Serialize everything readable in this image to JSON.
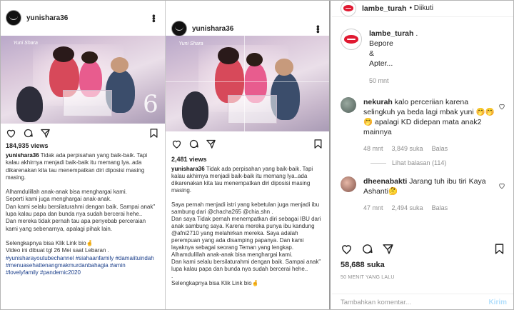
{
  "post1": {
    "username": "yunishara36",
    "views": "184,935 views",
    "caption_user": "yunishara36",
    "caption_paragraphs": [
      " Tidak ada perpisahan yang baik-baik.  Tapi kalau akhirnya menjadi baik-baik itu memang lya..ada dikarenakan kita tau menempatkan diri diposisi masing masing.",
      "",
      "Alhamdulillah anak-anak bisa menghargai kami.",
      "Seperti kami juga menghargai anak-anak.",
      "Dan kami selalu bersilaturahmi dengan baik. Sampai anak\" lupa kalau papa dan bunda nya sudah bercerai hehe..",
      "Dan mereka tidak pernah tau apa penyebab perceraian kami yang sebenarnya, apalagi pihak lain.",
      "",
      "Selengkapnya bisa Klik Link bio🤞",
      "Video ini dibuat tgl 26 Mei saat Lebaran ."
    ],
    "hashtags": "#yunisharayoutubechannel #siahaanfamily #damaiituindah #menuasehattenangmakmurdanbahagia #amin #lovelyfamily #pandemic2020",
    "photo_mark": "Yuni Shara"
  },
  "post2": {
    "username": "yunishara36",
    "likes": "2,481 views",
    "caption_user": "yunishara36",
    "caption_paragraphs": [
      " Tidak ada perpisahan yang baik-baik.  Tapi kalau akhirnya menjadi baik-baik itu memang lya..ada dikarenakan kita tau menempatkan diri diposisi masing masing.",
      "",
      "Saya pernah menjadi  istri yang kebetulan juga menjadi ibu sambung dari @chacha265 @chia.shn .",
      "Dan saya Tidak pernah menempatkan diri sebagai IBU dari anak sambung saya. Karena mereka punya ibu kandung @afni2710 yang melahirkan mereka. Saya adalah perempuan yang ada disamping papanya. Dan kami layaknya sebagai seorang Teman yang lengkap.",
      "Alhamdulillah anak-anak bisa menghargai kami.",
      "Dan kami selalu bersilaturahmi dengan baik. Sampai anak\" lupa kalau papa dan bunda nya sudah bercerai hehe..",
      ".",
      "Selengkapnya bisa Klik Link bio🤞"
    ],
    "photo_mark": "Yuni Shara"
  },
  "post3": {
    "username": "lambe_turah",
    "follow_status": "• Diikuti",
    "caption_user": "lambe_turah",
    "caption_lines": [
      " .",
      "Bepore",
      "&",
      "Apter..."
    ],
    "caption_time": "50 mnt",
    "comments": [
      {
        "user": "nekurah",
        "text": " kalo perceriian karena selingkuh ya beda lagi mbak yuni 🤭🤭🤭 apalagi KD didepan mata anak2 mainnya",
        "time": "48 mnt",
        "likes": "3,849 suka",
        "reply": "Balas",
        "view_replies": "Lihat balasan (114)"
      },
      {
        "user": "dheenabakti",
        "text": " Jarang tuh ibu tiri Kaya Ashanti🤔",
        "time": "47 mnt",
        "likes": "2,494 suka",
        "reply": "Balas"
      }
    ],
    "likes": "58,688 suka",
    "time_ago": "50 MENIT YANG LALU",
    "comment_placeholder": "Tambahkan komentar...",
    "send_label": "Kirim"
  },
  "colors": {
    "link": "#1a3e8a",
    "muted": "#8e8e8e",
    "brand_red": "#e01931",
    "send_disabled": "#b2dffc"
  },
  "icons": [
    "heart-icon",
    "comment-icon",
    "share-icon",
    "bookmark-icon",
    "more-icon"
  ]
}
